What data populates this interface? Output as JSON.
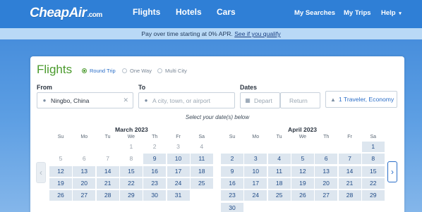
{
  "nav": {
    "logo": "CheapAir",
    "logo_suffix": ".com",
    "main": [
      "Flights",
      "Hotels",
      "Cars"
    ],
    "right": [
      "My Searches",
      "My Trips",
      "Help"
    ],
    "help_caret": "▾"
  },
  "promo": {
    "text": "Pay over time starting at 0% APR.",
    "link": "See if you qualify"
  },
  "search": {
    "title": "Flights",
    "trip_types": [
      {
        "label": "Round Trip",
        "selected": true
      },
      {
        "label": "One Way",
        "selected": false
      },
      {
        "label": "Multi City",
        "selected": false
      }
    ],
    "from_label": "From",
    "from_value": "Ningbo, China",
    "to_label": "To",
    "to_placeholder": "A city, town, or airport",
    "dates_label": "Dates",
    "depart_placeholder": "Depart",
    "return_placeholder": "Return",
    "traveler_value": "1 Traveler, Economy",
    "hint": "Select your date(s) below"
  },
  "calendar": {
    "weekdays": [
      "Su",
      "Mo",
      "Tu",
      "We",
      "Th",
      "Fr",
      "Sa"
    ],
    "months": [
      {
        "title": "March 2023",
        "rows": [
          [
            null,
            null,
            null,
            "1",
            "2",
            "3",
            "4"
          ],
          [
            "5",
            "6",
            "7",
            "8",
            "9",
            "10",
            "11"
          ],
          [
            "12",
            "13",
            "14",
            "15",
            "16",
            "17",
            "18"
          ],
          [
            "19",
            "20",
            "21",
            "22",
            "23",
            "24",
            "25"
          ],
          [
            "26",
            "27",
            "28",
            "29",
            "30",
            "31",
            null
          ]
        ],
        "first_active": "9"
      },
      {
        "title": "April 2023",
        "rows": [
          [
            null,
            null,
            null,
            null,
            null,
            null,
            "1"
          ],
          [
            "2",
            "3",
            "4",
            "5",
            "6",
            "7",
            "8"
          ],
          [
            "9",
            "10",
            "11",
            "12",
            "13",
            "14",
            "15"
          ],
          [
            "16",
            "17",
            "18",
            "19",
            "20",
            "21",
            "22"
          ],
          [
            "23",
            "24",
            "25",
            "26",
            "27",
            "28",
            "29"
          ],
          [
            "30",
            null,
            null,
            null,
            null,
            null,
            null
          ]
        ],
        "first_active": "1"
      }
    ],
    "prev_arrow": "‹",
    "next_arrow": "›"
  },
  "colors": {
    "brand_blue": "#2f7fd6",
    "flights_green": "#4a9a2c",
    "link_blue": "#2a6ec8"
  }
}
